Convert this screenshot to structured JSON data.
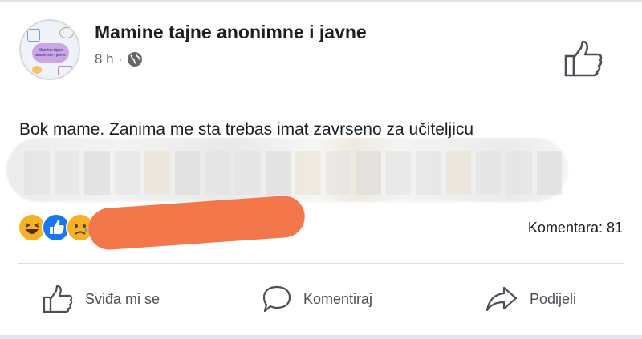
{
  "post": {
    "page_name": "Mamine tajne anonimne i javne",
    "avatar_badge_text": "Mamine tajne anonimne i javne",
    "time": "8 h",
    "separator": "·",
    "text": "Bok mame. Zanima me sta trebas imat zavrseno za učiteljicu"
  },
  "reactions": {
    "icons": [
      "haha-icon",
      "like-icon",
      "sad-icon"
    ],
    "comments_label": "Komentara: 81"
  },
  "actions": {
    "like_label": "Sviđa mi se",
    "comment_label": "Komentiraj",
    "share_label": "Podijeli"
  },
  "colors": {
    "like_blue": "#1877f2",
    "emoji_yellow": "#f7b125",
    "redaction_orange": "#f4774b",
    "secondary_text": "#65676b"
  }
}
